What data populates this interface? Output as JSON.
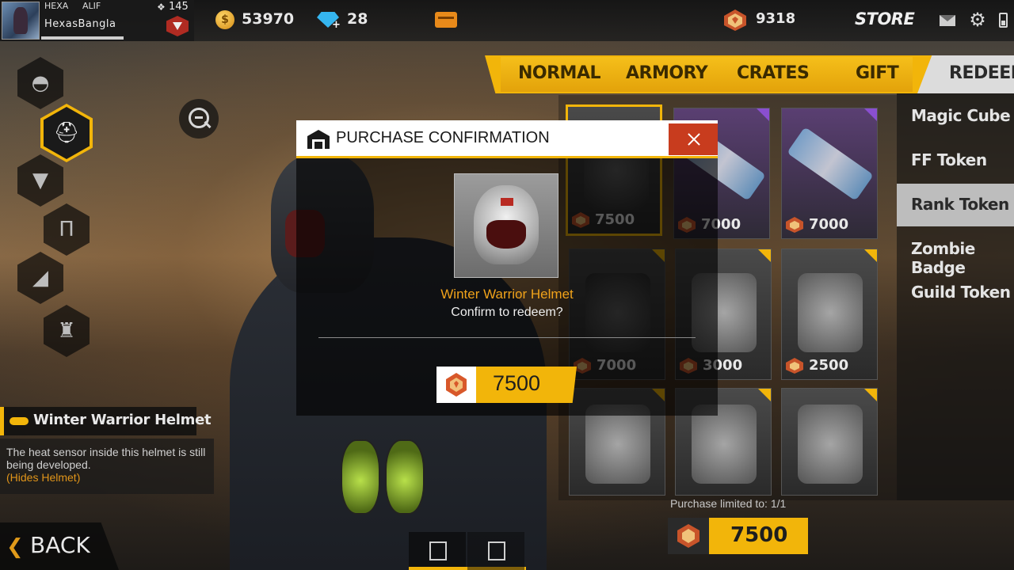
{
  "profile": {
    "tag_prefix": "HEXA",
    "tag_suffix": "ALIF",
    "name": "HexasBangla",
    "level": "145"
  },
  "currency": {
    "coins": "53970",
    "diamonds": "28",
    "tokens": "9318"
  },
  "topbar": {
    "store_label": "STORE"
  },
  "tabs": [
    {
      "label": "NORMAL"
    },
    {
      "label": "ARMORY"
    },
    {
      "label": "CRATES"
    },
    {
      "label": "GIFT"
    },
    {
      "label": "REDEEM"
    }
  ],
  "sub_categories": [
    {
      "label": "Magic Cube"
    },
    {
      "label": "FF Token"
    },
    {
      "label": "Rank Token"
    },
    {
      "label": "Zombie Badge"
    },
    {
      "label": "Guild Token"
    }
  ],
  "active_sub_category": "Rank Token",
  "grid": {
    "cards": [
      {
        "price": "7500"
      },
      {
        "price": "7000"
      },
      {
        "price": "7000"
      },
      {
        "price": "7000"
      },
      {
        "price": "3000"
      },
      {
        "price": "2500"
      },
      {
        "price": ""
      },
      {
        "price": ""
      },
      {
        "price": ""
      }
    ],
    "limit_text": "Purchase limited to: 1/1",
    "selected_price": "7500"
  },
  "item_info": {
    "title": "Winter Warrior Helmet",
    "description": "The heat sensor inside this helmet is still being developed.",
    "note": "(Hides Helmet)"
  },
  "back": {
    "label": "BACK"
  },
  "modal": {
    "title": "PURCHASE CONFIRMATION",
    "item_name": "Winter Warrior Helmet",
    "confirm_text": "Confirm to redeem?",
    "price": "7500"
  },
  "colors": {
    "accent": "#f2b50a",
    "close_red": "#c83c1e",
    "item_name_orange": "#f0a21a"
  },
  "icons": {
    "coin": "coin-icon",
    "diamond": "diamond-icon",
    "token": "rank-token-icon",
    "mail": "mail-icon",
    "settings": "gear-icon",
    "battery": "battery-icon",
    "zoom": "zoom-out-icon",
    "close": "close-icon"
  }
}
